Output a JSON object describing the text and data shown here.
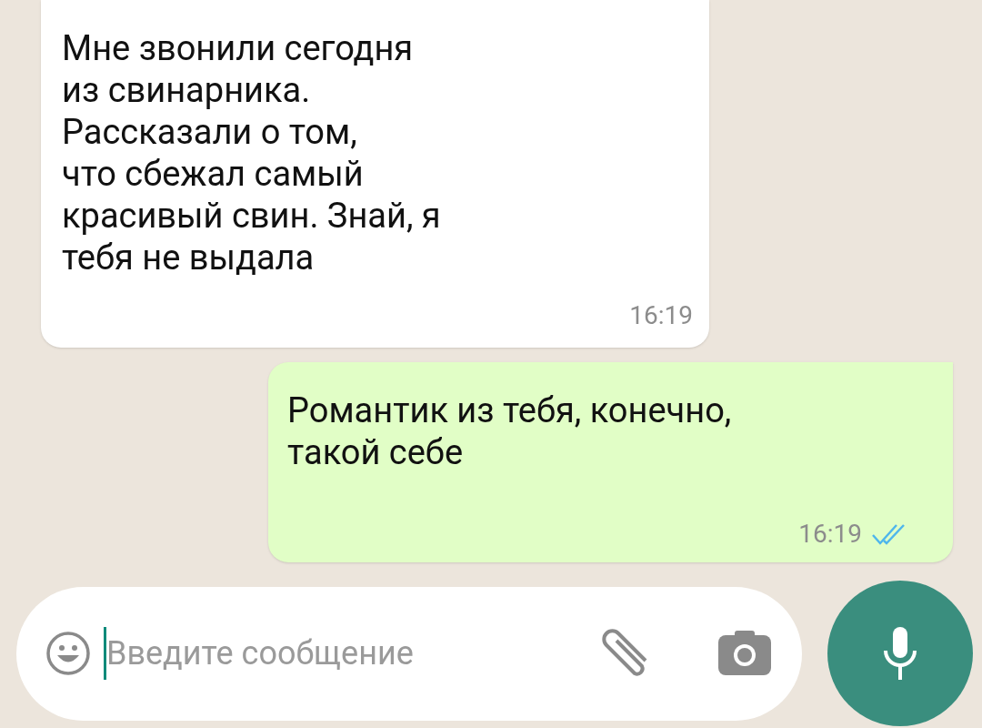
{
  "messages": [
    {
      "kind": "incoming",
      "text": "Мне звонили сегодня\nиз свинарника.\nРассказали о том,\nчто сбежал самый\nкрасивый свин. Знай, я\nтебя не выдала",
      "time": "16:19"
    },
    {
      "kind": "outgoing",
      "text": "Романтик из тебя, конечно,\nтакой себе",
      "time": "16:19",
      "read": true
    }
  ],
  "composer": {
    "placeholder": "Введите сообщение"
  }
}
